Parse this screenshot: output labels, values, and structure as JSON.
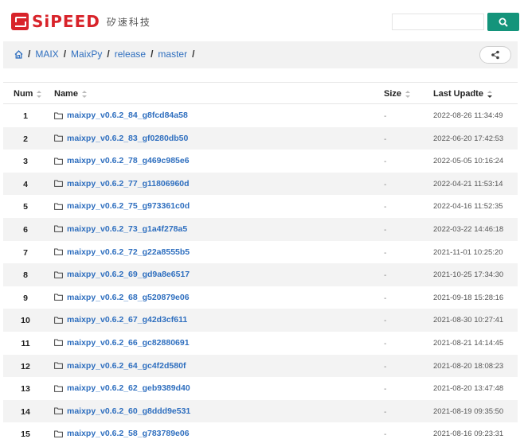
{
  "header": {
    "logo_text": "SiPEED",
    "logo_cn": "矽速科技",
    "search_placeholder": "",
    "search_icon": "search-icon",
    "accent_color": "#14947b",
    "brand_color": "#d8232a"
  },
  "breadcrumb": {
    "home_icon": "home-icon",
    "items": [
      "MAIX",
      "MaixPy",
      "release",
      "master"
    ],
    "separator": "/",
    "share_icon": "share-icon"
  },
  "table": {
    "columns": {
      "num": "Num",
      "name": "Name",
      "size": "Size",
      "date": "Last Upadte"
    },
    "rows": [
      {
        "num": "1",
        "name": "maixpy_v0.6.2_84_g8fcd84a58",
        "size": "-",
        "date": "2022-08-26 11:34:49"
      },
      {
        "num": "2",
        "name": "maixpy_v0.6.2_83_gf0280db50",
        "size": "-",
        "date": "2022-06-20 17:42:53"
      },
      {
        "num": "3",
        "name": "maixpy_v0.6.2_78_g469c985e6",
        "size": "-",
        "date": "2022-05-05 10:16:24"
      },
      {
        "num": "4",
        "name": "maixpy_v0.6.2_77_g11806960d",
        "size": "-",
        "date": "2022-04-21 11:53:14"
      },
      {
        "num": "5",
        "name": "maixpy_v0.6.2_75_g973361c0d",
        "size": "-",
        "date": "2022-04-16 11:52:35"
      },
      {
        "num": "6",
        "name": "maixpy_v0.6.2_73_g1a4f278a5",
        "size": "-",
        "date": "2022-03-22 14:46:18"
      },
      {
        "num": "7",
        "name": "maixpy_v0.6.2_72_g22a8555b5",
        "size": "-",
        "date": "2021-11-01 10:25:20"
      },
      {
        "num": "8",
        "name": "maixpy_v0.6.2_69_gd9a8e6517",
        "size": "-",
        "date": "2021-10-25 17:34:30"
      },
      {
        "num": "9",
        "name": "maixpy_v0.6.2_68_g520879e06",
        "size": "-",
        "date": "2021-09-18 15:28:16"
      },
      {
        "num": "10",
        "name": "maixpy_v0.6.2_67_g42d3cf611",
        "size": "-",
        "date": "2021-08-30 10:27:41"
      },
      {
        "num": "11",
        "name": "maixpy_v0.6.2_66_gc82880691",
        "size": "-",
        "date": "2021-08-21 14:14:45"
      },
      {
        "num": "12",
        "name": "maixpy_v0.6.2_64_gc4f2d580f",
        "size": "-",
        "date": "2021-08-20 18:08:23"
      },
      {
        "num": "13",
        "name": "maixpy_v0.6.2_62_geb9389d40",
        "size": "-",
        "date": "2021-08-20 13:47:48"
      },
      {
        "num": "14",
        "name": "maixpy_v0.6.2_60_g8ddd9e531",
        "size": "-",
        "date": "2021-08-19 09:35:50"
      },
      {
        "num": "15",
        "name": "maixpy_v0.6.2_58_g783789e06",
        "size": "-",
        "date": "2021-08-16 09:23:31"
      }
    ]
  }
}
